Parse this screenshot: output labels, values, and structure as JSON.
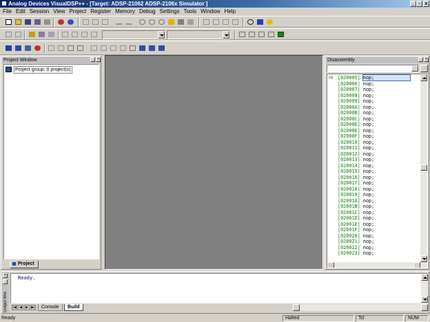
{
  "window": {
    "title": "Analog Devices VisualDSP++ - [Target: ADSP-21062 ADSP-2106x Simulator ]",
    "minimize_label": "_",
    "maximize_label": "▫",
    "close_label": "x"
  },
  "menu": [
    "File",
    "Edit",
    "Session",
    "View",
    "Project",
    "Register",
    "Memory",
    "Debug",
    "Settings",
    "Tools",
    "Window",
    "Help"
  ],
  "project_window": {
    "title": "Project Window",
    "tree_item": "Project group: 0 project(s)",
    "tab_label": "Project"
  },
  "disassembly": {
    "title": "Disassembly",
    "current_index": 0,
    "lines": [
      {
        "addr": "[020005]",
        "ins": "nop;"
      },
      {
        "addr": "[020006]",
        "ins": "nop;"
      },
      {
        "addr": "[020007]",
        "ins": "nop;"
      },
      {
        "addr": "[020008]",
        "ins": "nop;"
      },
      {
        "addr": "[020009]",
        "ins": "nop;"
      },
      {
        "addr": "[02000A]",
        "ins": "nop;"
      },
      {
        "addr": "[02000B]",
        "ins": "nop;"
      },
      {
        "addr": "[02000C]",
        "ins": "nop;"
      },
      {
        "addr": "[02000D]",
        "ins": "nop;"
      },
      {
        "addr": "[02000E]",
        "ins": "nop;"
      },
      {
        "addr": "[02000F]",
        "ins": "nop;"
      },
      {
        "addr": "[020010]",
        "ins": "nop;"
      },
      {
        "addr": "[020011]",
        "ins": "nop;"
      },
      {
        "addr": "[020012]",
        "ins": "nop;"
      },
      {
        "addr": "[020013]",
        "ins": "nop;"
      },
      {
        "addr": "[020014]",
        "ins": "nop;"
      },
      {
        "addr": "[020015]",
        "ins": "nop;"
      },
      {
        "addr": "[020016]",
        "ins": "nop;"
      },
      {
        "addr": "[020017]",
        "ins": "nop;"
      },
      {
        "addr": "[020018]",
        "ins": "nop;"
      },
      {
        "addr": "[020019]",
        "ins": "nop;"
      },
      {
        "addr": "[02001A]",
        "ins": "nop;"
      },
      {
        "addr": "[02001B]",
        "ins": "nop;"
      },
      {
        "addr": "[02001C]",
        "ins": "nop;"
      },
      {
        "addr": "[02001D]",
        "ins": "nop;"
      },
      {
        "addr": "[02001E]",
        "ins": "nop;"
      },
      {
        "addr": "[02001F]",
        "ins": "nop;"
      },
      {
        "addr": "[020020]",
        "ins": "nop;"
      },
      {
        "addr": "[020021]",
        "ins": "nop;"
      },
      {
        "addr": "[020022]",
        "ins": "nop;"
      },
      {
        "addr": "[020023]",
        "ins": "nop;"
      }
    ]
  },
  "output_window": {
    "title": "Output Win",
    "text": "Ready.",
    "tabs": [
      "Console",
      "Build"
    ],
    "active_tab": "Build"
  },
  "status_bar": {
    "message": "Ready",
    "state": "Halted",
    "lang": "Tcl",
    "num": "NUM"
  },
  "colors": {
    "address": "#008000",
    "selection": "#3a6ea5",
    "mdi_background": "#808080"
  }
}
